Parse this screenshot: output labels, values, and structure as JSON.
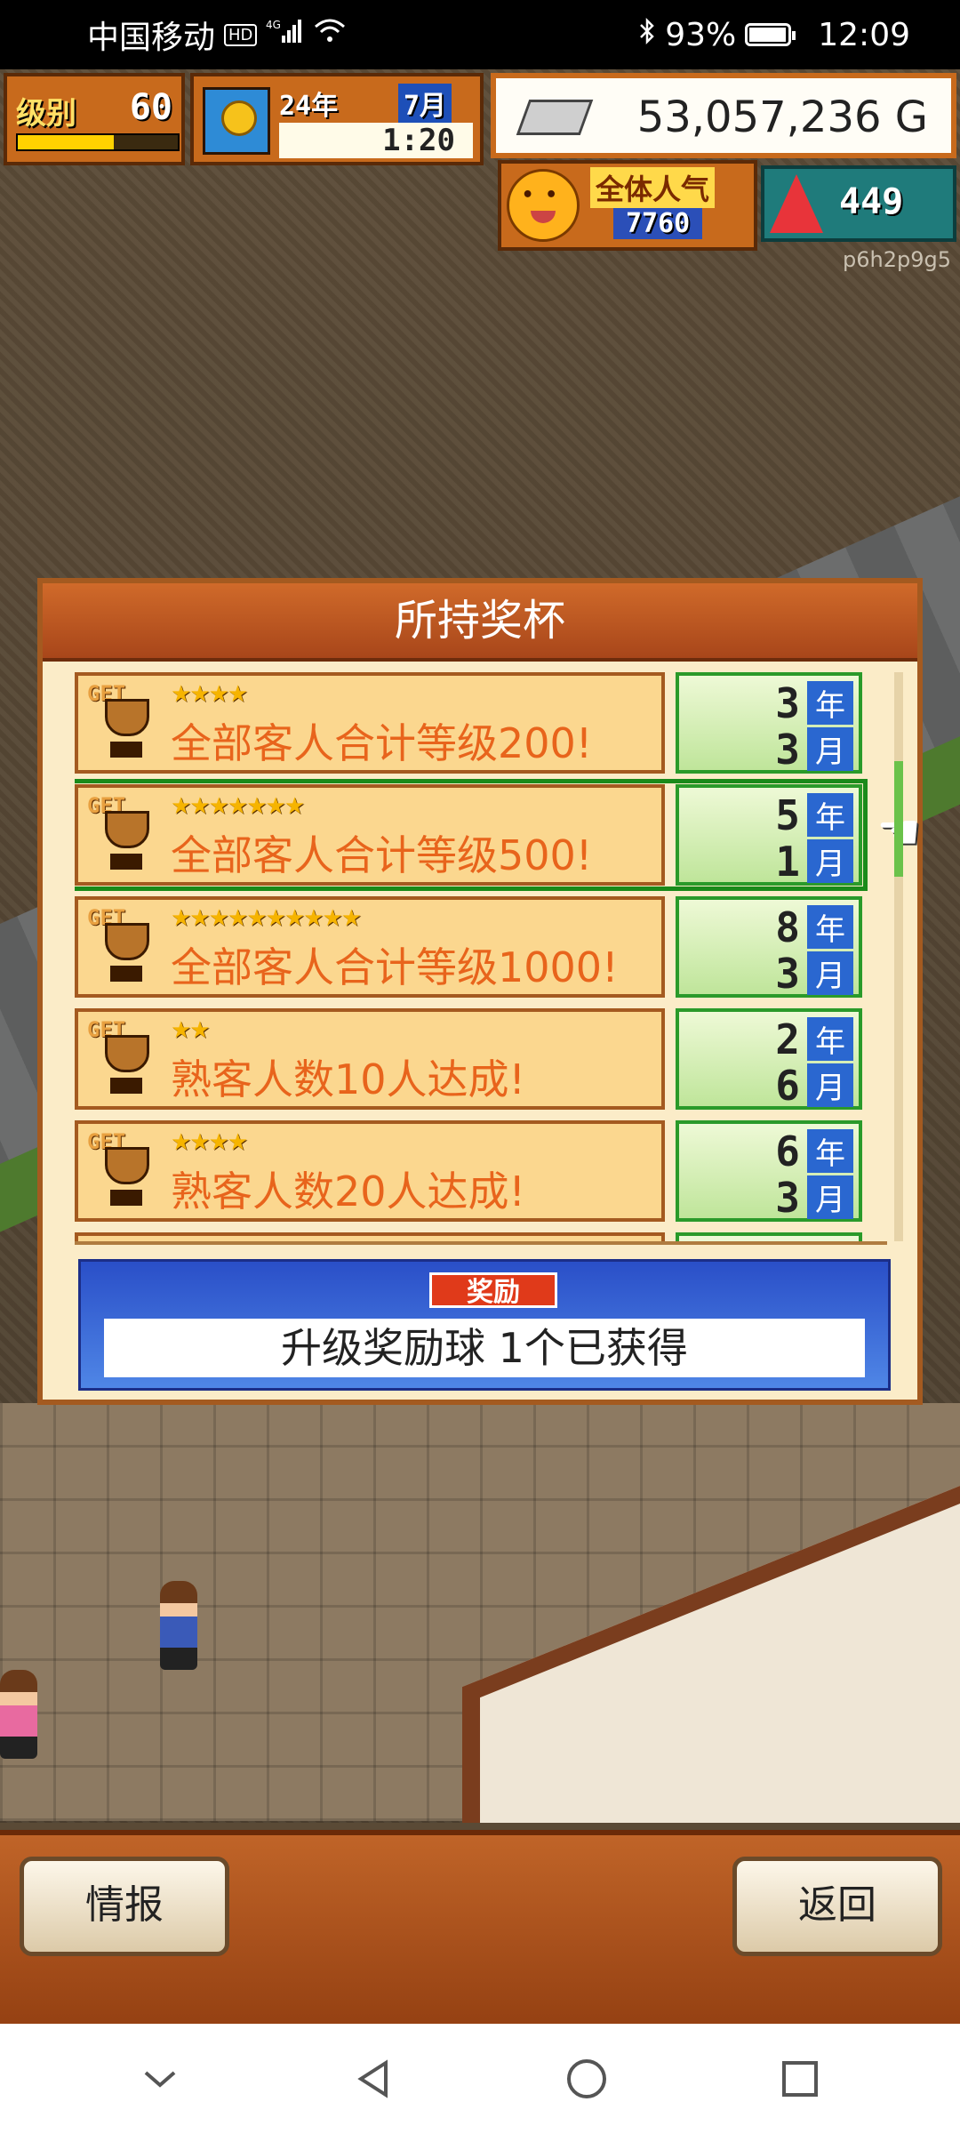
{
  "status_bar": {
    "carrier": "中国移动",
    "hd": "HD",
    "signal": "4G",
    "battery_percent": "93%",
    "battery_level": 0.93,
    "time": "12:09"
  },
  "hud": {
    "level_label": "级别",
    "level_value": "60",
    "level_progress": 0.6,
    "year": "24年",
    "month": "7月",
    "clock": "1:20",
    "money": "53,057,236 G",
    "popularity_label": "全体人气",
    "popularity_value": "7760",
    "alert_value": "449",
    "user_code": "p6h2p9g5"
  },
  "dialog": {
    "title": "所持奖杯",
    "trophies": [
      {
        "stars": "★★★★",
        "title": "全部客人合计等级200!",
        "year": "3",
        "month": "3"
      },
      {
        "stars": "★★★★★★★",
        "title": "全部客人合计等级500!",
        "year": "5",
        "month": "1"
      },
      {
        "stars": "★★★★★★★★★★",
        "title": "全部客人合计等级1000!",
        "year": "8",
        "month": "3"
      },
      {
        "stars": "★★",
        "title": "熟客人数10人达成!",
        "year": "2",
        "month": "6"
      },
      {
        "stars": "★★★★",
        "title": "熟客人数20人达成!",
        "year": "6",
        "month": "3"
      }
    ],
    "get_label": "GET",
    "year_unit": "年",
    "month_unit": "月",
    "reward_label": "奖励",
    "reward_text": "升级奖励球 1个已获得"
  },
  "bottom_bar": {
    "info_label": "情报",
    "back_label": "返回"
  },
  "colors": {
    "accent": "#c86a1c",
    "highlight": "#1a8a1a",
    "reward_blue": "#2a4fc8"
  }
}
